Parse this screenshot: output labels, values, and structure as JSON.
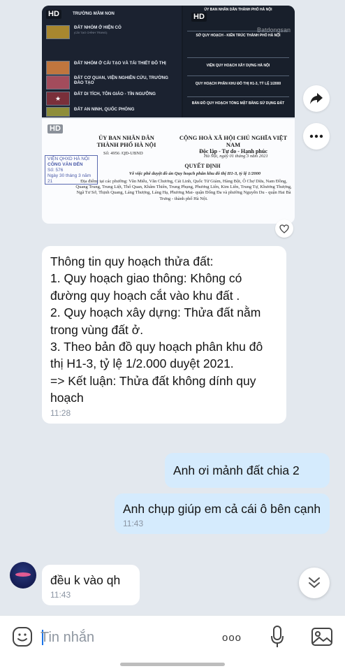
{
  "legend_image": {
    "hd_badge_left": "HD",
    "hd_badge_right": "HD",
    "watermark": "Batdongsan",
    "items": [
      {
        "label": "TRƯỜNG MẦM NON",
        "sub": "",
        "color": "#bfa34a"
      },
      {
        "label": "ĐẤT NHÓM Ở HIỆN CÓ",
        "sub": "(CẢI TẠO CHỈNH TRANG)",
        "color": "#a8872f"
      },
      {
        "label": "ĐẤT NHÓM Ở CẢI TẠO VÀ TÁI THIẾT ĐÔ THỊ",
        "sub": "",
        "color": "#c0763e"
      },
      {
        "label": "ĐẤT CƠ QUAN, VIỆN NGHIÊN CỨU, TRƯỜNG ĐÀO TẠO",
        "sub": "",
        "color": "#a34c5c"
      },
      {
        "label": "ĐẤT DI TÍCH, TÔN GIÁO - TÍN NGƯỠNG",
        "sub": "",
        "color": "#7a2f3a"
      },
      {
        "label": "ĐẤT AN NINH, QUỐC PHÒNG",
        "sub": "",
        "color": "#8e8e3a"
      }
    ],
    "title_block": [
      "ỦY BAN NHÂN DÂN THÀNH PHỐ HÀ NỘI",
      "SỞ QUY HOẠCH - KIẾN TRÚC THÀNH PHỐ HÀ NỘI",
      "VIỆN QUY HOẠCH XÂY DỰNG HÀ NỘI",
      "QUY HOẠCH PHÂN KHU ĐÔ THỊ H1-3, TỶ LỆ 1/2000",
      "BẢN ĐỒ QUY HOẠCH TỔNG MẶT BẰNG SỬ DỤNG ĐẤT"
    ]
  },
  "doc_image": {
    "hd_badge": "HD",
    "left_header_1": "ỦY BAN NHÂN DÂN",
    "left_header_2": "THÀNH PHỐ HÀ NỘI",
    "doc_number": "Số: 4956 /QĐ-UBND",
    "right_header_1": "CỘNG HOÀ XÃ HỘI CHỦ NGHĨA VIỆT NAM",
    "right_header_2": "Độc lập - Tự do - Hạnh phúc",
    "date": "Hà Nội, ngày 01 tháng 3 năm 2021",
    "stamp_line_1": "VIỆN QHXD HÀ NỘI",
    "stamp_line_2": "CÔNG VĂN ĐẾN",
    "stamp_line_3": "Số: 576",
    "stamp_line_4": "Ngày 30 tháng 3 năm 21",
    "title": "QUYẾT ĐỊNH",
    "subject": "Về việc phê duyệt đồ án Quy hoạch phân khu đô thị H1-3, tỷ lệ 1/2000",
    "body": "Địa điểm: tại các phường: Văn Miếu, Văn Chương, Cát Linh, Quốc Tử Giám, Hàng Bột, Ô Chợ Dừa, Nam Đồng, Quang Trung, Trung Liệt, Thổ Quan, Khâm Thiên, Trung Phụng, Phương Liên, Kim Liên, Trung Tự, Khương Thượng, Ngã Tư Sở, Thịnh Quang, Láng Thượng, Láng Hạ, Phương Mai- quận Đống Đa và phường Nguyễn Du - quận Hai Bà Trưng - thành phố Hà Nội."
  },
  "messages": [
    {
      "side": "in",
      "text": "Thông tin quy hoạch thửa đất:\n1. Quy hoạch giao thông: Không có đường quy hoạch cắt vào khu đất .\n2. Quy hoạch xây dựng: Thửa đất nằm trong vùng đất ở.\n3. Theo bản đồ quy hoạch phân khu đô thị H1-3, tỷ lệ 1/2.000 duyệt 2021.\n=> Kết luận: Thửa đất không dính quy hoạch",
      "time": "11:28"
    },
    {
      "side": "out",
      "text": "Anh ơi mảnh đất chia 2",
      "time": ""
    },
    {
      "side": "out",
      "text": "Anh chụp giúp em cả cái ô bên cạnh",
      "time": "11:43"
    },
    {
      "side": "in",
      "text": "đều k vào qh",
      "time": "11:43"
    }
  ],
  "input": {
    "placeholder": "Tin nhắn",
    "more_label": "ooo"
  },
  "colors": {
    "background": "#e3e8ee",
    "incoming": "#ffffff",
    "outgoing": "#d5ebfd",
    "accent": "#1a73e8"
  }
}
